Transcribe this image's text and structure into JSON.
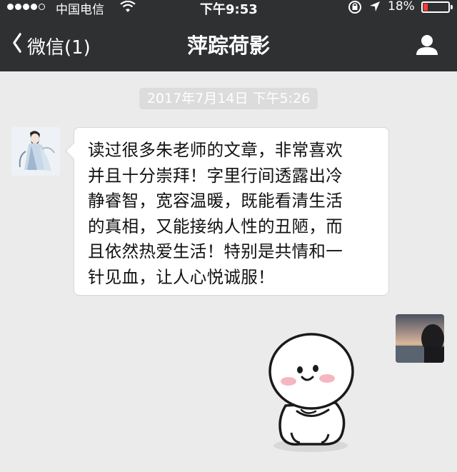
{
  "status_bar": {
    "carrier": "中国电信",
    "time": "下午9:53",
    "battery_percent": "18%",
    "signal_bars": 4,
    "battery_level": 0.18,
    "battery_color": "#ff3b30"
  },
  "nav": {
    "back_label": "微信(1)",
    "title": "萍踪荷影",
    "profile_icon": "person-icon"
  },
  "chat": {
    "timestamp": "2017年7月14日 下午5:26",
    "messages": [
      {
        "sender": "other",
        "type": "text",
        "text": "读过很多朱老师的文章，非常喜欢\n并且十分崇拜！字里行间透露出冷\n静睿智，宽容温暖，既能看清生活\n的真相，又能接纳人性的丑陋，而\n且依然热爱生活！特别是共情和一\n针见血，让人心悦诚服！"
      },
      {
        "sender": "self",
        "type": "sticker",
        "sticker": "shy-dumpling-sticker"
      }
    ]
  },
  "colors": {
    "nav_background": "#2e3032",
    "chat_background": "#ebebeb",
    "bubble_background": "#ffffff",
    "timestamp_background": "#dcdcdc"
  }
}
